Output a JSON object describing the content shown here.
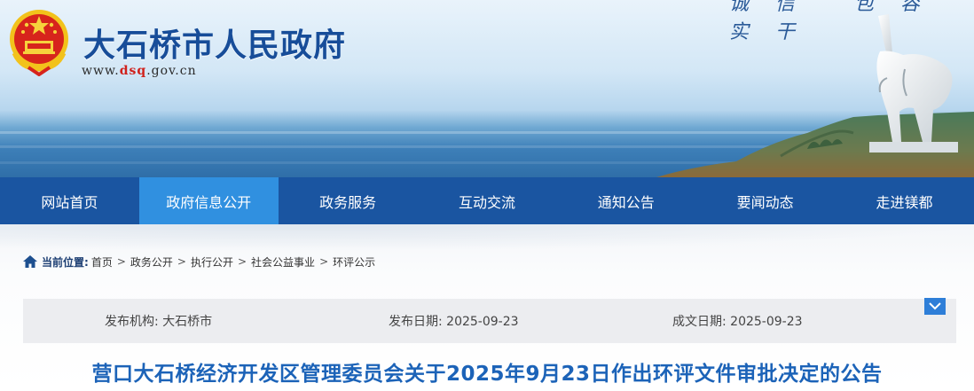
{
  "header": {
    "site_title": "大石桥市人民政府",
    "url_prefix": "www.",
    "url_highlight": "dsq",
    "url_suffix": ".gov.cn",
    "slogan": "诚信 包容 实干"
  },
  "nav": {
    "items": [
      {
        "label": "网站首页",
        "active": false
      },
      {
        "label": "政府信息公开",
        "active": true
      },
      {
        "label": "政务服务",
        "active": false
      },
      {
        "label": "互动交流",
        "active": false
      },
      {
        "label": "通知公告",
        "active": false
      },
      {
        "label": "要闻动态",
        "active": false
      },
      {
        "label": "走进镁都",
        "active": false
      }
    ]
  },
  "breadcrumb": {
    "label": "当前位置:",
    "items": [
      "首页",
      "政务公开",
      "执行公开",
      "社会公益事业",
      "环评公示"
    ],
    "separator": ">"
  },
  "info": {
    "publisher_label": "发布机构:",
    "publisher": "大石桥市",
    "publish_date_label": "发布日期:",
    "publish_date": "2025-09-23",
    "created_date_label": "成文日期:",
    "created_date": "2025-09-23"
  },
  "article": {
    "title": "营口大石桥经济开发区管理委员会关于2025年9月23日作出环评文件审批决定的公告"
  },
  "colors": {
    "nav_bg": "#1a55a1",
    "nav_active": "#3090e0",
    "title_blue": "#1c63b8",
    "site_title": "#174d99"
  },
  "icons": {
    "breadcrumb": "home-icon",
    "toggle": "chevron-down-icon",
    "emblem": "national-emblem-icon"
  }
}
